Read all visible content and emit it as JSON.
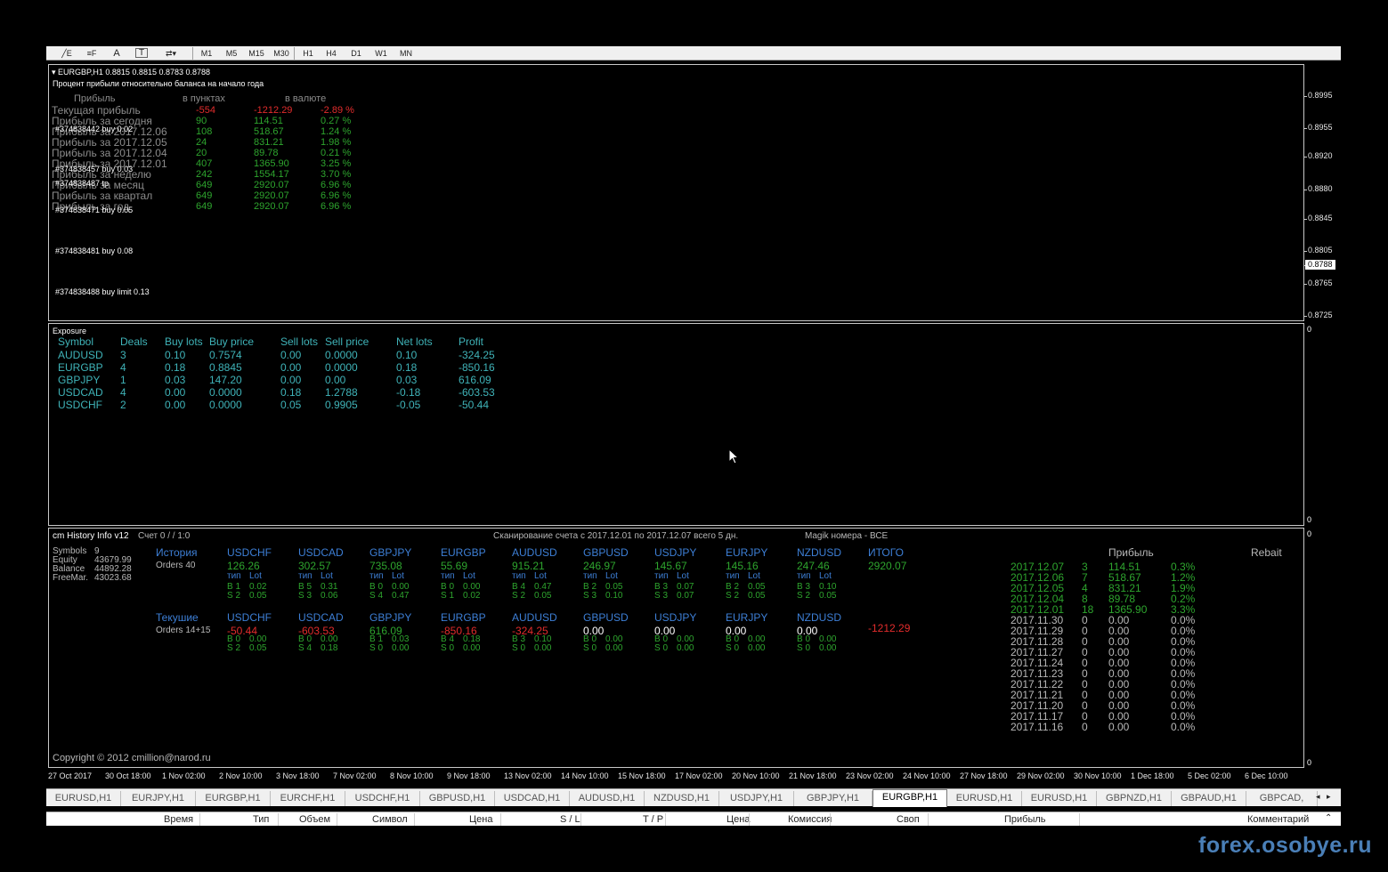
{
  "toolbar": {
    "timeframes": [
      "M1",
      "M5",
      "M15",
      "M30",
      "H1",
      "H4",
      "D1",
      "W1",
      "MN"
    ]
  },
  "chart1": {
    "header": "EURGBP,H1  0.8815 0.8815 0.8783 0.8788",
    "subtitle": "Процент прибыли относительно баланса на начало года",
    "col_headers": [
      "Прибыль",
      "в пунктах",
      "в валюте"
    ],
    "rows": [
      {
        "label": "Текущая прибыль",
        "points": "-554",
        "money": "-1212.29",
        "pct": "-2.89 %",
        "neg": true
      },
      {
        "label": "Прибыль за сегодня",
        "points": "90",
        "money": "114.51",
        "pct": "0.27 %"
      },
      {
        "label": "Прибыль за 2017.12.06",
        "points": "108",
        "money": "518.67",
        "pct": "1.24 %"
      },
      {
        "label": "Прибыль за 2017.12.05",
        "points": "24",
        "money": "831.21",
        "pct": "1.98 %"
      },
      {
        "label": "Прибыль за 2017.12.04",
        "points": "20",
        "money": "89.78",
        "pct": "0.21 %"
      },
      {
        "label": "Прибыль за 2017.12.01",
        "points": "407",
        "money": "1365.90",
        "pct": "3.25 %"
      },
      {
        "label": "Прибыль за неделю",
        "points": "242",
        "money": "1554.17",
        "pct": "3.70 %"
      },
      {
        "label": "Прибыль за месяц",
        "points": "649",
        "money": "2920.07",
        "pct": "6.96 %"
      },
      {
        "label": "Прибыль за квартал",
        "points": "649",
        "money": "2920.07",
        "pct": "6.96 %"
      },
      {
        "label": "Прибыль за год",
        "points": "649",
        "money": "2920.07",
        "pct": "6.96 %"
      }
    ],
    "orders": [
      "#374838442 buy 0.02",
      "#374838457 buy 0.03",
      "#374838487 tp",
      "#374838471 buy 0.05",
      "#374838481 buy 0.08",
      "#374838488 buy limit 0.13"
    ],
    "price_labels": [
      "0.8995",
      "0.8955",
      "0.8920",
      "0.8880",
      "0.8845",
      "0.8805",
      "0.8788",
      "0.8765",
      "0.8725"
    ]
  },
  "exposure": {
    "title": "Exposure",
    "headers": [
      "Symbol",
      "Deals",
      "Buy lots",
      "Buy price",
      "Sell lots",
      "Sell price",
      "Net lots",
      "Profit"
    ],
    "rows": [
      [
        "AUDUSD",
        "3",
        "0.10",
        "0.7574",
        "0.00",
        "0.0000",
        "0.10",
        "-324.25"
      ],
      [
        "EURGBP",
        "4",
        "0.18",
        "0.8845",
        "0.00",
        "0.0000",
        "0.18",
        "-850.16"
      ],
      [
        "GBPJPY",
        "1",
        "0.03",
        "147.20",
        "0.00",
        "0.00",
        "0.03",
        "616.09"
      ],
      [
        "USDCAD",
        "4",
        "0.00",
        "0.0000",
        "0.18",
        "1.2788",
        "-0.18",
        "-603.53"
      ],
      [
        "USDCHF",
        "2",
        "0.00",
        "0.0000",
        "0.05",
        "0.9905",
        "-0.05",
        "-50.44"
      ]
    ],
    "scale_top": "0",
    "scale_bottom": "0"
  },
  "history": {
    "title": "cm History Info v12",
    "account": "Счет 0 /  / 1:0",
    "scan": "Сканирование счета с 2017.12.01 по 2017.12.07 всего 5 дн.",
    "magic": "Magik номера - ВСЕ",
    "stats": [
      {
        "k": "Symbols",
        "v": "9"
      },
      {
        "k": "Equity",
        "v": "43679.99"
      },
      {
        "k": "Balance",
        "v": "44892.28"
      },
      {
        "k": "FreeMar.",
        "v": "43023.68"
      }
    ],
    "history_label": "История",
    "orders_label": "Orders 40",
    "current_label": "Текушие",
    "current_orders": "Orders 14+15",
    "type_label": "тип",
    "lot_label": "Lot",
    "total_label": "ИТОГО",
    "history_total": "2920.07",
    "current_total": "-1212.29",
    "hist_syms": [
      {
        "sym": "USDCHF",
        "val": "126.26",
        "b": "B 1",
        "bl": "0.02",
        "s": "S 2",
        "sl": "0.05"
      },
      {
        "sym": "USDCAD",
        "val": "302.57",
        "b": "B 5",
        "bl": "0.31",
        "s": "S 3",
        "sl": "0.06"
      },
      {
        "sym": "GBPJPY",
        "val": "735.08",
        "b": "B 0",
        "bl": "0.00",
        "s": "S 4",
        "sl": "0.47"
      },
      {
        "sym": "EURGBP",
        "val": "55.69",
        "b": "B 0",
        "bl": "0.00",
        "s": "S 1",
        "sl": "0.02"
      },
      {
        "sym": "AUDUSD",
        "val": "915.21",
        "b": "B 4",
        "bl": "0.47",
        "s": "S 2",
        "sl": "0.05"
      },
      {
        "sym": "GBPUSD",
        "val": "246.97",
        "b": "B 2",
        "bl": "0.05",
        "s": "S 3",
        "sl": "0.10"
      },
      {
        "sym": "USDJPY",
        "val": "145.67",
        "b": "B 3",
        "bl": "0.07",
        "s": "S 3",
        "sl": "0.07"
      },
      {
        "sym": "EURJPY",
        "val": "145.16",
        "b": "B 2",
        "bl": "0.05",
        "s": "S 2",
        "sl": "0.05"
      },
      {
        "sym": "NZDUSD",
        "val": "247.46",
        "b": "B 3",
        "bl": "0.10",
        "s": "S 2",
        "sl": "0.05"
      }
    ],
    "cur_syms": [
      {
        "sym": "USDCHF",
        "val": "-50.44",
        "b": "B 0",
        "bl": "0.00",
        "s": "S 2",
        "sl": "0.05",
        "c": "red"
      },
      {
        "sym": "USDCAD",
        "val": "-603.53",
        "b": "B 0",
        "bl": "0.00",
        "s": "S 4",
        "sl": "0.18",
        "c": "red"
      },
      {
        "sym": "GBPJPY",
        "val": "616.09",
        "b": "B 1",
        "bl": "0.03",
        "s": "S 0",
        "sl": "0.00",
        "c": "green"
      },
      {
        "sym": "EURGBP",
        "val": "-850.16",
        "b": "B 4",
        "bl": "0.18",
        "s": "S 0",
        "sl": "0.00",
        "c": "red"
      },
      {
        "sym": "AUDUSD",
        "val": "-324.25",
        "b": "B 3",
        "bl": "0.10",
        "s": "S 0",
        "sl": "0.00",
        "c": "red"
      },
      {
        "sym": "GBPUSD",
        "val": "0.00",
        "b": "B 0",
        "bl": "0.00",
        "s": "S 0",
        "sl": "0.00",
        "c": "white"
      },
      {
        "sym": "USDJPY",
        "val": "0.00",
        "b": "B 0",
        "bl": "0.00",
        "s": "S 0",
        "sl": "0.00",
        "c": "white"
      },
      {
        "sym": "EURJPY",
        "val": "0.00",
        "b": "B 0",
        "bl": "0.00",
        "s": "S 0",
        "sl": "0.00",
        "c": "white"
      },
      {
        "sym": "NZDUSD",
        "val": "0.00",
        "b": "B 0",
        "bl": "0.00",
        "s": "S 0",
        "sl": "0.00",
        "c": "white"
      }
    ],
    "profit_header": "Прибыль",
    "rebait_header": "Rebait",
    "daily": [
      {
        "d": "2017.12.07",
        "n": "3",
        "p": "114.51",
        "pct": "0.3%",
        "g": true
      },
      {
        "d": "2017.12.06",
        "n": "7",
        "p": "518.67",
        "pct": "1.2%",
        "g": true
      },
      {
        "d": "2017.12.05",
        "n": "4",
        "p": "831.21",
        "pct": "1.9%",
        "g": true
      },
      {
        "d": "2017.12.04",
        "n": "8",
        "p": "89.78",
        "pct": "0.2%",
        "g": true
      },
      {
        "d": "2017.12.01",
        "n": "18",
        "p": "1365.90",
        "pct": "3.3%",
        "g": true
      },
      {
        "d": "2017.11.30",
        "n": "0",
        "p": "0.00",
        "pct": "0.0%"
      },
      {
        "d": "2017.11.29",
        "n": "0",
        "p": "0.00",
        "pct": "0.0%"
      },
      {
        "d": "2017.11.28",
        "n": "0",
        "p": "0.00",
        "pct": "0.0%"
      },
      {
        "d": "2017.11.27",
        "n": "0",
        "p": "0.00",
        "pct": "0.0%"
      },
      {
        "d": "2017.11.24",
        "n": "0",
        "p": "0.00",
        "pct": "0.0%"
      },
      {
        "d": "2017.11.23",
        "n": "0",
        "p": "0.00",
        "pct": "0.0%"
      },
      {
        "d": "2017.11.22",
        "n": "0",
        "p": "0.00",
        "pct": "0.0%"
      },
      {
        "d": "2017.11.21",
        "n": "0",
        "p": "0.00",
        "pct": "0.0%"
      },
      {
        "d": "2017.11.20",
        "n": "0",
        "p": "0.00",
        "pct": "0.0%"
      },
      {
        "d": "2017.11.17",
        "n": "0",
        "p": "0.00",
        "pct": "0.0%"
      },
      {
        "d": "2017.11.16",
        "n": "0",
        "p": "0.00",
        "pct": "0.0%"
      }
    ],
    "copyright": "Copyright © 2012 cmillion@narod.ru",
    "scale_top": "0",
    "scale_bottom": "0"
  },
  "time_axis": [
    "27 Oct 2017",
    "30 Oct 18:00",
    "1 Nov 02:00",
    "2 Nov 10:00",
    "3 Nov 18:00",
    "7 Nov 02:00",
    "8 Nov 10:00",
    "9 Nov 18:00",
    "13 Nov 02:00",
    "14 Nov 10:00",
    "15 Nov 18:00",
    "17 Nov 02:00",
    "20 Nov 10:00",
    "21 Nov 18:00",
    "23 Nov 02:00",
    "24 Nov 10:00",
    "27 Nov 18:00",
    "29 Nov 02:00",
    "30 Nov 10:00",
    "1 Dec 18:00",
    "5 Dec 02:00",
    "6 Dec 10:00"
  ],
  "tabs": [
    "EURUSD,H1",
    "EURJPY,H1",
    "EURGBP,H1",
    "EURCHF,H1",
    "USDCHF,H1",
    "GBPUSD,H1",
    "USDCAD,H1",
    "AUDUSD,H1",
    "NZDUSD,H1",
    "USDJPY,H1",
    "GBPJPY,H1",
    "EURGBP,H1",
    "EURUSD,H1",
    "EURUSD,H1",
    "GBPNZD,H1",
    "GBPAUD,H1",
    "GBPCAD,"
  ],
  "active_tab": 11,
  "bottom_headers": [
    "Время",
    "Тип",
    "Объем",
    "Символ",
    "Цена",
    "S / L",
    "T / P",
    "Цена",
    "Комиссия",
    "Своп",
    "Прибыль",
    "Комментарий"
  ],
  "watermark": "forex.osobye.ru",
  "colors": {
    "green": "#2ea52e",
    "red": "#e22c2c",
    "teal": "#3fb3b8",
    "blue": "#3d7fd6"
  }
}
